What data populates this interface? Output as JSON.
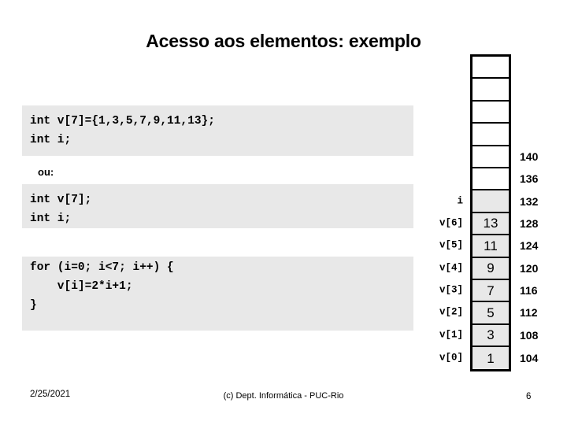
{
  "slide": {
    "title": "Acesso aos elementos: exemplo",
    "alt_label": "ou:"
  },
  "code_blocks": [
    {
      "id": "code-block-1",
      "lines": [
        "int v[7]={1,3,5,7,9,11,13};",
        "int i;"
      ]
    },
    {
      "id": "code-block-2",
      "lines": [
        "int v[7];",
        "int i;"
      ]
    },
    {
      "id": "code-block-3",
      "lines": [
        "for (i=0; i<7; i++) {",
        "    v[i]=2*i+1;",
        "}"
      ]
    }
  ],
  "memory_diagram": {
    "cells": [
      {
        "label": "",
        "value": "",
        "address": "",
        "filled": false
      },
      {
        "label": "",
        "value": "",
        "address": "",
        "filled": false
      },
      {
        "label": "",
        "value": "",
        "address": "",
        "filled": false
      },
      {
        "label": "",
        "value": "",
        "address": "",
        "filled": false
      },
      {
        "label": "",
        "value": "",
        "address": "140",
        "filled": false
      },
      {
        "label": "",
        "value": "",
        "address": "136",
        "filled": false
      },
      {
        "label": "i",
        "value": "",
        "address": "132",
        "filled": true
      },
      {
        "label": "v[6]",
        "value": "13",
        "address": "128",
        "filled": true
      },
      {
        "label": "v[5]",
        "value": "11",
        "address": "124",
        "filled": true
      },
      {
        "label": "v[4]",
        "value": "9",
        "address": "120",
        "filled": true
      },
      {
        "label": "v[3]",
        "value": "7",
        "address": "116",
        "filled": true
      },
      {
        "label": "v[2]",
        "value": "5",
        "address": "112",
        "filled": true
      },
      {
        "label": "v[1]",
        "value": "3",
        "address": "108",
        "filled": true
      },
      {
        "label": "v[0]",
        "value": "1",
        "address": "104",
        "filled": true
      }
    ]
  },
  "footer": {
    "date": "2/25/2021",
    "credit": "(c) Dept. Informática - PUC-Rio",
    "slide_number": "6"
  },
  "colors": {
    "code_background": "#e8e8e8",
    "cell_fill": "#e8e8e8",
    "border": "#000000",
    "text": "#000000",
    "page_background": "#ffffff"
  }
}
